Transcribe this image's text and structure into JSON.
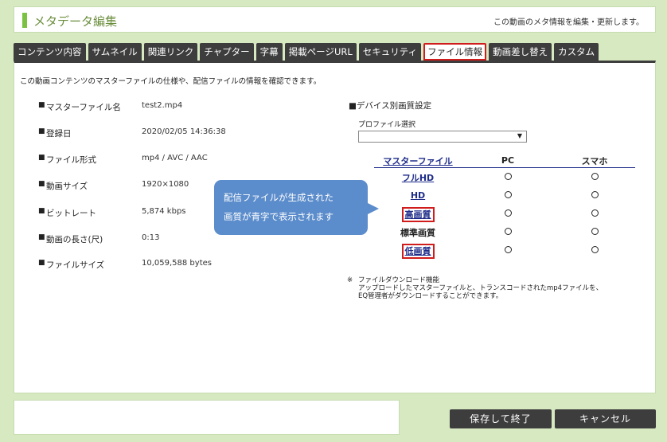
{
  "header": {
    "title": "メタデータ編集",
    "description": "この動画のメタ情報を編集・更新します。"
  },
  "tabs": [
    {
      "label": "コンテンツ内容"
    },
    {
      "label": "サムネイル"
    },
    {
      "label": "関連リンク"
    },
    {
      "label": "チャプター"
    },
    {
      "label": "字幕"
    },
    {
      "label": "掲載ページURL"
    },
    {
      "label": "セキュリティ"
    },
    {
      "label": "ファイル情報"
    },
    {
      "label": "動画差し替え"
    },
    {
      "label": "カスタム"
    }
  ],
  "panel": {
    "intro": "この動画コンテンツのマスターファイルの仕様や、配信ファイルの情報を確認できます。",
    "info": [
      {
        "label": "マスターファイル名",
        "value": "test2.mp4"
      },
      {
        "label": "登録日",
        "value": "2020/02/05 14:36:38"
      },
      {
        "label": "ファイル形式",
        "value": "mp4 / AVC / AAC"
      },
      {
        "label": "動画サイズ",
        "value": "1920×1080"
      },
      {
        "label": "ビットレート",
        "value": "5,874 kbps"
      },
      {
        "label": "動画の長さ(尺)",
        "value": "0:13"
      },
      {
        "label": "ファイルサイズ",
        "value": "10,059,588 bytes"
      }
    ],
    "bullet": "■",
    "device_title": "■デバイス別画質設定",
    "profile_label": "プロファイル選択",
    "profile_value": "",
    "table": {
      "headers": [
        "マスターファイル",
        "PC",
        "スマホ"
      ],
      "rows": [
        {
          "name": "フルHD"
        },
        {
          "name": "HD"
        },
        {
          "name": "高画質"
        },
        {
          "name": "標準画質"
        },
        {
          "name": "低画質"
        }
      ]
    },
    "note_mark": "※",
    "note_lines": [
      "ファイルダウンロード機能",
      "アップロードしたマスターファイルと、トランスコードされたmp4ファイルを、",
      "EQ管理者がダウンロードすることができます。"
    ]
  },
  "callout": {
    "line1": "配信ファイルが生成された",
    "line2": "画質が青字で表示されます"
  },
  "buttons": {
    "save": "保存して終了",
    "cancel": "キャンセル"
  }
}
